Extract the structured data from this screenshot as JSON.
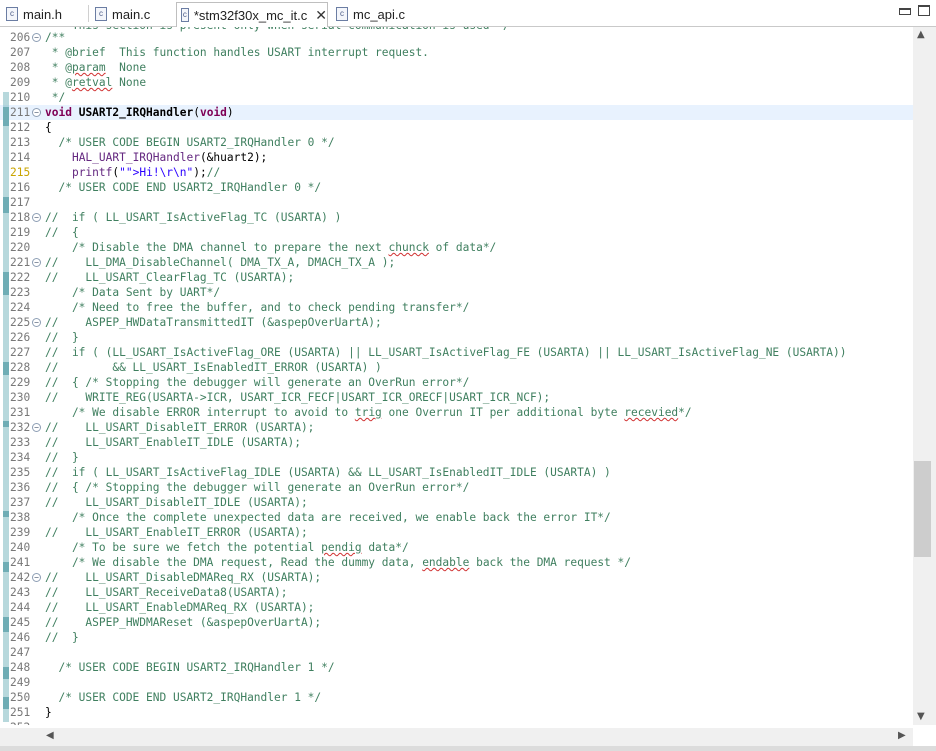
{
  "tabs": [
    {
      "label": "main.h",
      "icon": "c-file-icon",
      "active": false
    },
    {
      "label": "main.c",
      "icon": "c-file-icon",
      "active": false
    },
    {
      "label": "*stm32f30x_mc_it.c",
      "icon": "c-file-icon",
      "active": true,
      "close": "✕"
    },
    {
      "label": "mc_api.c",
      "icon": "c-file-icon",
      "active": false
    }
  ],
  "file_icon_letter": "c",
  "current_line": 211,
  "colors": {
    "comment": "#3f7f5f",
    "keyword": "#7f0055",
    "string": "#2a00ff",
    "current_line_bg": "#e8f2fe",
    "change_marker": "#5fa0a8"
  },
  "editor": {
    "partial_top_line": " *  This section is present only when serial communication is used */",
    "lines": [
      {
        "n": "206",
        "fold": "−",
        "code": "/**"
      },
      {
        "n": "207",
        "code": " * @brief  This function handles USART interrupt request."
      },
      {
        "n": "208",
        "code": " * @param  None"
      },
      {
        "n": "209",
        "code": " * @retval None"
      },
      {
        "n": "210",
        "code": " */"
      },
      {
        "n": "211",
        "fold": "−",
        "code": "void USART2_IRQHandler(void)"
      },
      {
        "n": "212",
        "code": "{"
      },
      {
        "n": "213",
        "code": "  /* USER CODE BEGIN USART2_IRQHandler 0 */"
      },
      {
        "n": "214",
        "code": "    HAL_UART_IRQHandler(&huart2);"
      },
      {
        "n": "215",
        "code": "    printf(\"Hi!\\r\\n\");//"
      },
      {
        "n": "216",
        "code": "  /* USER CODE END USART2_IRQHandler 0 */"
      },
      {
        "n": "217",
        "code": ""
      },
      {
        "n": "218",
        "fold": "−",
        "code": "//  if ( LL_USART_IsActiveFlag_TC (USARTA) )"
      },
      {
        "n": "219",
        "code": "//  {"
      },
      {
        "n": "220",
        "code": "    /* Disable the DMA channel to prepare the next chunck of data*/"
      },
      {
        "n": "221",
        "fold": "−",
        "code": "//    LL_DMA_DisableChannel( DMA_TX_A, DMACH_TX_A );"
      },
      {
        "n": "222",
        "code": "//    LL_USART_ClearFlag_TC (USARTA);"
      },
      {
        "n": "223",
        "code": "    /* Data Sent by UART*/"
      },
      {
        "n": "224",
        "code": "    /* Need to free the buffer, and to check pending transfer*/"
      },
      {
        "n": "225",
        "fold": "−",
        "code": "//    ASPEP_HWDataTransmittedIT (&aspepOverUartA);"
      },
      {
        "n": "226",
        "code": "//  }"
      },
      {
        "n": "227",
        "code": "//  if ( (LL_USART_IsActiveFlag_ORE (USARTA) || LL_USART_IsActiveFlag_FE (USARTA) || LL_USART_IsActiveFlag_NE (USARTA))"
      },
      {
        "n": "228",
        "code": "//        && LL_USART_IsEnabledIT_ERROR (USARTA) )"
      },
      {
        "n": "229",
        "code": "//  { /* Stopping the debugger will generate an OverRun error*/"
      },
      {
        "n": "230",
        "code": "//    WRITE_REG(USARTA->ICR, USART_ICR_FECF|USART_ICR_ORECF|USART_ICR_NCF);"
      },
      {
        "n": "231",
        "code": "    /* We disable ERROR interrupt to avoid to trig one Overrun IT per additional byte recevied*/"
      },
      {
        "n": "232",
        "fold": "−",
        "code": "//    LL_USART_DisableIT_ERROR (USARTA);"
      },
      {
        "n": "233",
        "code": "//    LL_USART_EnableIT_IDLE (USARTA);"
      },
      {
        "n": "234",
        "code": "//  }"
      },
      {
        "n": "235",
        "code": "//  if ( LL_USART_IsActiveFlag_IDLE (USARTA) && LL_USART_IsEnabledIT_IDLE (USARTA) )"
      },
      {
        "n": "236",
        "code": "//  { /* Stopping the debugger will generate an OverRun error*/"
      },
      {
        "n": "237",
        "code": "//    LL_USART_DisableIT_IDLE (USARTA);"
      },
      {
        "n": "238",
        "code": "    /* Once the complete unexpected data are received, we enable back the error IT*/"
      },
      {
        "n": "239",
        "code": "//    LL_USART_EnableIT_ERROR (USARTA);"
      },
      {
        "n": "240",
        "code": "    /* To be sure we fetch the potential pendig data*/"
      },
      {
        "n": "241",
        "code": "    /* We disable the DMA request, Read the dummy data, endable back the DMA request */"
      },
      {
        "n": "242",
        "fold": "−",
        "code": "//    LL_USART_DisableDMAReq_RX (USARTA);"
      },
      {
        "n": "243",
        "code": "//    LL_USART_ReceiveData8(USARTA);"
      },
      {
        "n": "244",
        "code": "//    LL_USART_EnableDMAReq_RX (USARTA);"
      },
      {
        "n": "245",
        "code": "//    ASPEP_HWDMAReset (&aspepOverUartA);"
      },
      {
        "n": "246",
        "code": "//  }"
      },
      {
        "n": "247",
        "code": ""
      },
      {
        "n": "248",
        "code": "  /* USER CODE BEGIN USART2_IRQHandler 1 */"
      },
      {
        "n": "249",
        "code": ""
      },
      {
        "n": "250",
        "code": "  /* USER CODE END USART2_IRQHandler 1 */"
      },
      {
        "n": "251",
        "code": "}"
      }
    ],
    "partial_bottom_line": {
      "n": "252",
      "code": ""
    }
  },
  "scroll_arrows": {
    "up": "▲",
    "down": "▼",
    "left": "◀",
    "right": "▶"
  }
}
